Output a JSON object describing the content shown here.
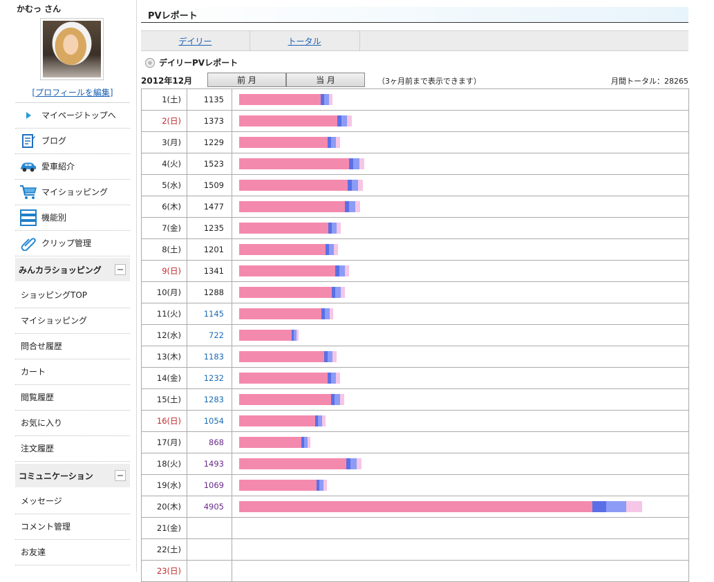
{
  "user": {
    "name": "かむっ さん",
    "edit_profile": "プロフィールを編集"
  },
  "nav": [
    {
      "label": "マイページトップへ",
      "icon": "triangle-right-icon"
    },
    {
      "label": "ブログ",
      "icon": "blog-notebook-icon"
    },
    {
      "label": "愛車紹介",
      "icon": "car-icon"
    },
    {
      "label": "マイショッピング",
      "icon": "shopping-cart-icon"
    },
    {
      "label": "機能別",
      "icon": "list-stack-icon"
    },
    {
      "label": "クリップ管理",
      "icon": "paperclip-icon"
    }
  ],
  "shopping_section": {
    "title": "みんカラショッピング",
    "items": [
      "ショッピングTOP",
      "マイショッピング",
      "問合せ履歴",
      "カート",
      "閲覧履歴",
      "お気に入り",
      "注文履歴"
    ]
  },
  "communication_section": {
    "title": "コミュニケーション",
    "items": [
      "メッセージ",
      "コメント管理",
      "お友達"
    ]
  },
  "page": {
    "title": "PVレポート",
    "tabs": [
      "デイリー",
      "トータル"
    ],
    "report_title": "デイリーPVレポート",
    "month": "2012年12月",
    "prev_month": "前 月",
    "this_month": "当 月",
    "note": "（3ヶ月前まで表示できます）",
    "monthly_total": "月間トータル：28265"
  },
  "colors": {
    "pink": "#f489ae",
    "blue": "#5a6fe6",
    "light_blue": "#8c9cf6",
    "light_pink": "#f6c6e6",
    "sunday_red": "#c0282c"
  },
  "days": [
    {
      "day": "1(土)",
      "pv": "1135",
      "v": 1135,
      "c": ""
    },
    {
      "day": "2(日)",
      "pv": "1373",
      "v": 1373,
      "c": "",
      "red": true
    },
    {
      "day": "3(月)",
      "pv": "1229",
      "v": 1229,
      "c": ""
    },
    {
      "day": "4(火)",
      "pv": "1523",
      "v": 1523,
      "c": ""
    },
    {
      "day": "5(水)",
      "pv": "1509",
      "v": 1509,
      "c": ""
    },
    {
      "day": "6(木)",
      "pv": "1477",
      "v": 1477,
      "c": ""
    },
    {
      "day": "7(金)",
      "pv": "1235",
      "v": 1235,
      "c": ""
    },
    {
      "day": "8(土)",
      "pv": "1201",
      "v": 1201,
      "c": ""
    },
    {
      "day": "9(日)",
      "pv": "1341",
      "v": 1341,
      "c": "",
      "red": true
    },
    {
      "day": "10(月)",
      "pv": "1288",
      "v": 1288,
      "c": ""
    },
    {
      "day": "11(火)",
      "pv": "1145",
      "v": 1145,
      "c": "blue"
    },
    {
      "day": "12(水)",
      "pv": "722",
      "v": 722,
      "c": "blue"
    },
    {
      "day": "13(木)",
      "pv": "1183",
      "v": 1183,
      "c": "blue"
    },
    {
      "day": "14(金)",
      "pv": "1232",
      "v": 1232,
      "c": "blue"
    },
    {
      "day": "15(土)",
      "pv": "1283",
      "v": 1283,
      "c": "blue"
    },
    {
      "day": "16(日)",
      "pv": "1054",
      "v": 1054,
      "c": "blue",
      "red": true
    },
    {
      "day": "17(月)",
      "pv": "868",
      "v": 868,
      "c": "purple"
    },
    {
      "day": "18(火)",
      "pv": "1493",
      "v": 1493,
      "c": "purple"
    },
    {
      "day": "19(水)",
      "pv": "1069",
      "v": 1069,
      "c": "purple"
    },
    {
      "day": "20(木)",
      "pv": "4905",
      "v": 4905,
      "c": "purple"
    },
    {
      "day": "21(金)",
      "pv": "",
      "v": 0,
      "c": ""
    },
    {
      "day": "22(土)",
      "pv": "",
      "v": 0,
      "c": ""
    },
    {
      "day": "23(日)",
      "pv": "",
      "v": 0,
      "c": "",
      "red": true
    }
  ]
}
